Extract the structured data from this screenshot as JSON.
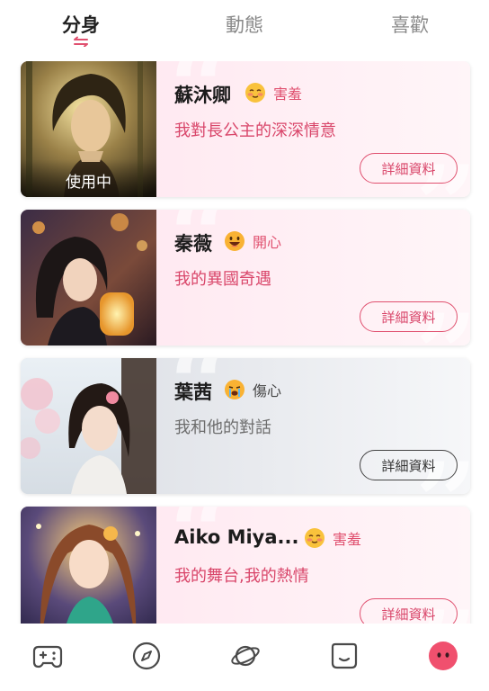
{
  "tabs": [
    {
      "label": "分身",
      "active": true
    },
    {
      "label": "動態",
      "active": false
    },
    {
      "label": "喜歡",
      "active": false
    }
  ],
  "cards": [
    {
      "name": "蘇沐卿",
      "mood": "害羞",
      "mood_icon": "blushing-face-icon",
      "subtitle": "我對長公主的深深情意",
      "status": "使用中",
      "button": "詳細資料",
      "theme": "pink"
    },
    {
      "name": "秦薇",
      "mood": "開心",
      "mood_icon": "grinning-face-icon",
      "subtitle": "我的異國奇遇",
      "button": "詳細資料",
      "theme": "pink"
    },
    {
      "name": "葉茜",
      "mood": "傷心",
      "mood_icon": "crying-face-icon",
      "subtitle": "我和他的對話",
      "button": "詳細資料",
      "theme": "gray"
    },
    {
      "name": "Aiko Miya...",
      "mood": "害羞",
      "mood_icon": "blushing-face-icon",
      "subtitle": "我的舞台,我的熱情",
      "button": "詳細資料",
      "theme": "pink"
    }
  ],
  "bottom_nav": [
    {
      "icon": "gamepad-icon"
    },
    {
      "icon": "compass-icon"
    },
    {
      "icon": "planet-icon"
    },
    {
      "icon": "chat-face-icon"
    },
    {
      "icon": "profile-face-icon",
      "active": true
    }
  ],
  "colors": {
    "accent": "#e0506f",
    "tab_underline": "#e0506f",
    "nav_active": "#f0506e"
  }
}
